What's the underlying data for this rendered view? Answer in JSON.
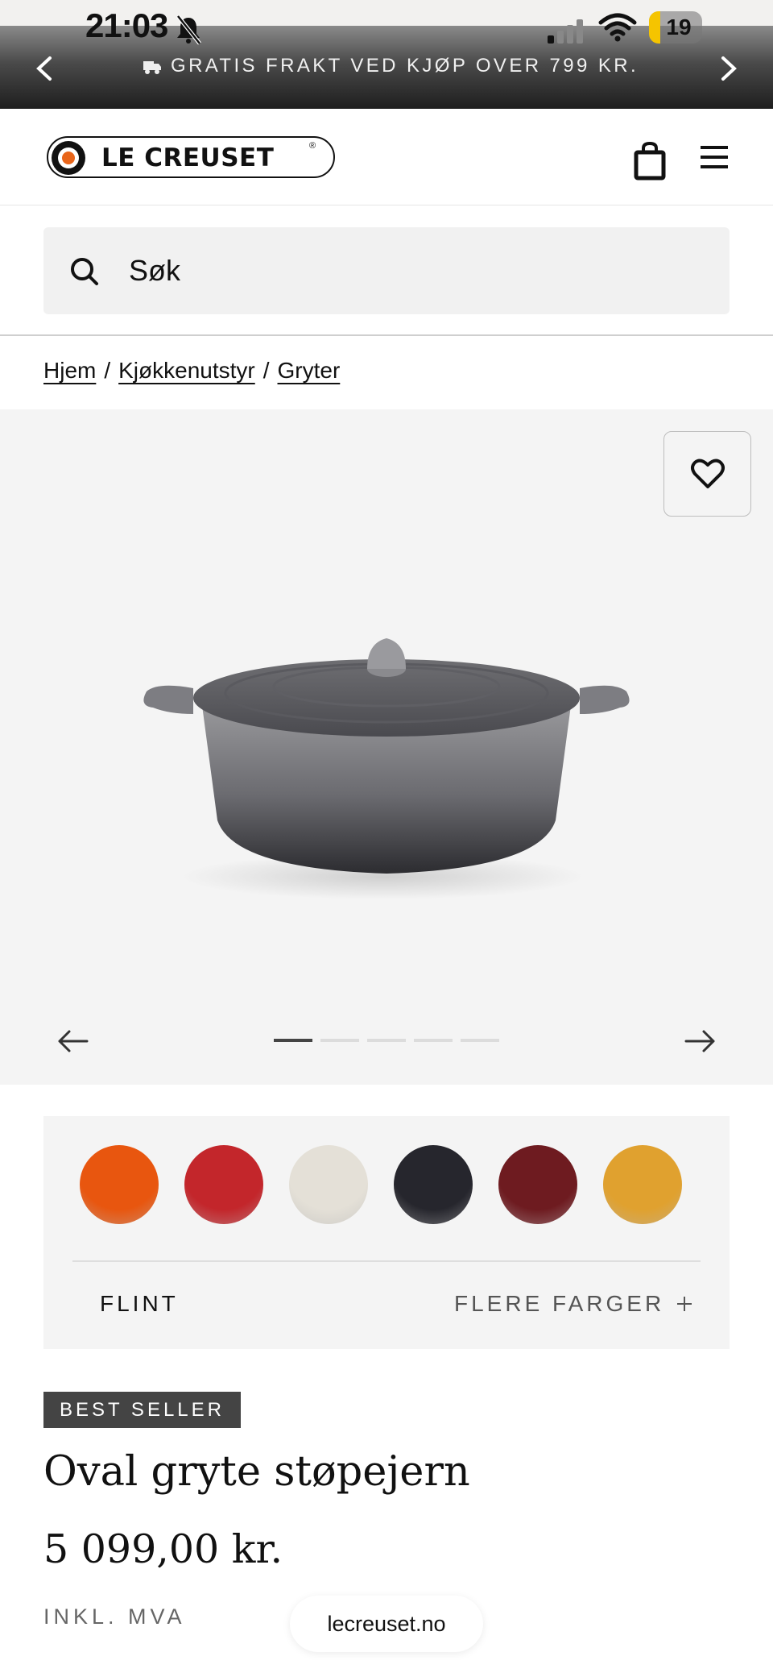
{
  "status_bar": {
    "time": "21:03",
    "battery": "19"
  },
  "banner": {
    "text": "GRATIS FRAKT VED KJØP OVER 799 KR."
  },
  "header": {
    "logo_text": "LE CREUSET",
    "logo_reg": "®"
  },
  "search": {
    "placeholder": "Søk"
  },
  "breadcrumb": {
    "items": [
      "Hjem",
      "Kjøkkenutstyr",
      "Gryter"
    ],
    "separator": "/"
  },
  "gallery": {
    "slide_count": 5,
    "active_slide": 1
  },
  "colors": {
    "swatches": [
      {
        "name": "orange",
        "hex": "#e8560f"
      },
      {
        "name": "red",
        "hex": "#c3262b"
      },
      {
        "name": "cream",
        "hex": "#e4e0d7"
      },
      {
        "name": "black",
        "hex": "#26262d"
      },
      {
        "name": "burgundy",
        "hex": "#6e1b20"
      },
      {
        "name": "yellow",
        "hex": "#e0a12f"
      }
    ],
    "selected_label": "FLINT",
    "more_label": "FLERE FARGER"
  },
  "product": {
    "badge": "BEST SELLER",
    "title": "Oval gryte støpejern",
    "price": "5 099,00 kr.",
    "vat_note": "INKL. MVA"
  },
  "browser": {
    "url": "lecreuset.no"
  }
}
